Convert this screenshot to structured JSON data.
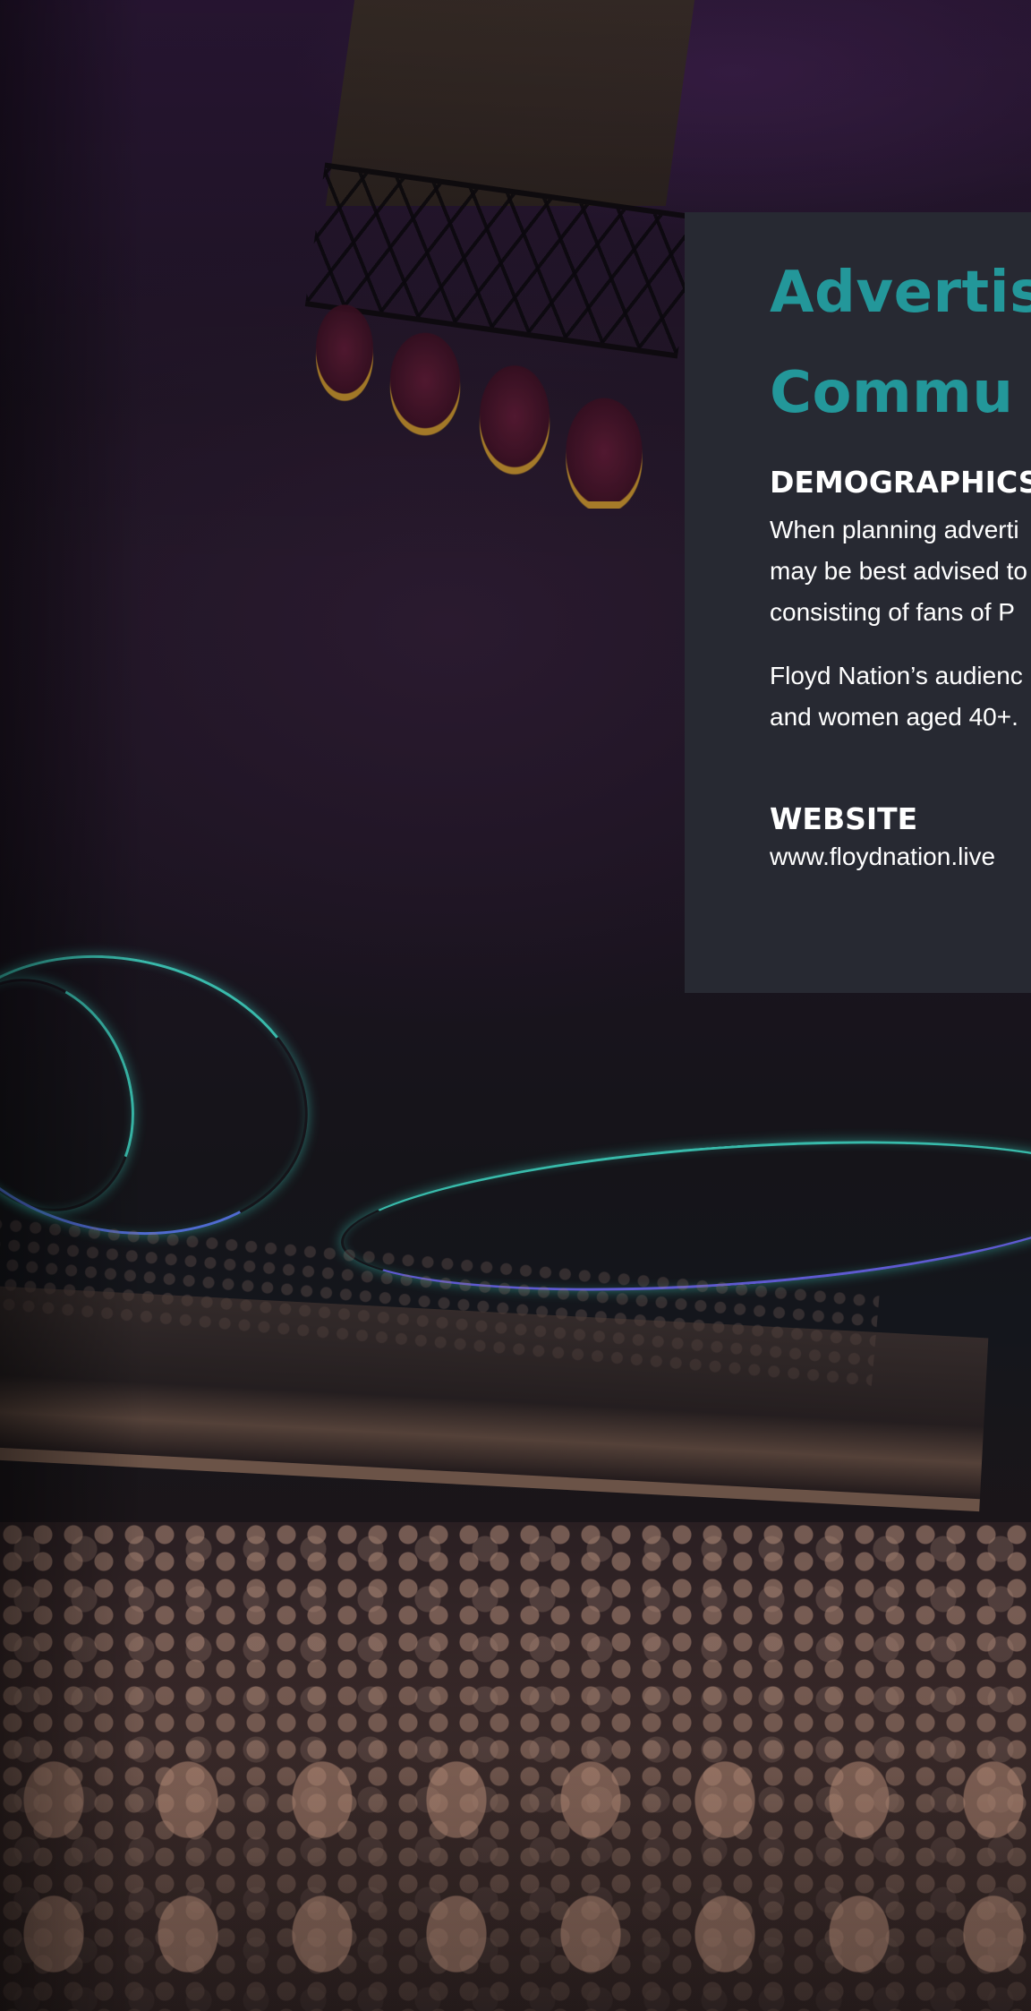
{
  "card": {
    "title_line1": "Advertis",
    "title_line2": "Commu",
    "demographics": {
      "heading": "DEMOGRAPHICS",
      "paragraph1_lines": [
        "When planning adverti",
        "may be best advised to",
        "consisting of fans of P"
      ],
      "paragraph2_lines": [
        "Floyd Nation’s audienc",
        "and women aged 40+."
      ]
    },
    "website": {
      "heading": "WEBSITE",
      "url": "www.floydnation.live"
    }
  },
  "colors": {
    "card_background": "#272932",
    "title_accent": "#23979a",
    "text": "#ffffff"
  }
}
